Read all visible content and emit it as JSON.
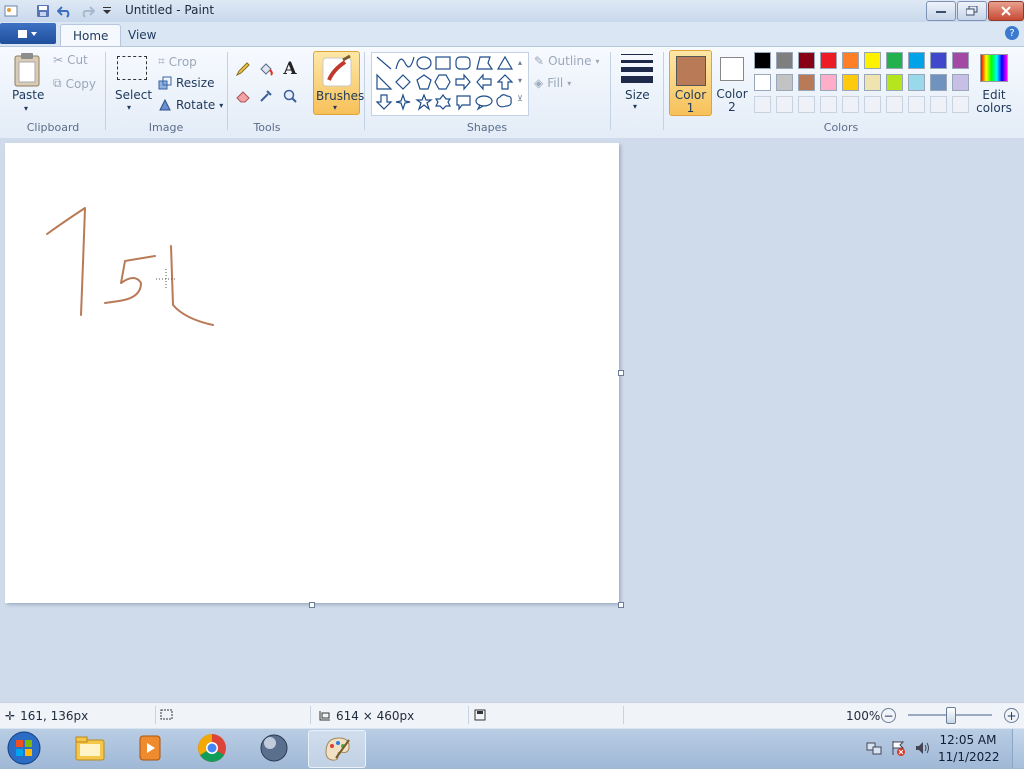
{
  "window": {
    "title": "Untitled - Paint"
  },
  "tabs": {
    "home": "Home",
    "view": "View"
  },
  "ribbon": {
    "clipboard": {
      "paste": "Paste",
      "cut": "Cut",
      "copy": "Copy",
      "group": "Clipboard"
    },
    "image": {
      "select": "Select",
      "crop": "Crop",
      "resize": "Resize",
      "rotate": "Rotate",
      "group": "Image"
    },
    "tools": {
      "group": "Tools"
    },
    "brushes": {
      "label": "Brushes"
    },
    "shapes": {
      "outline": "Outline",
      "fill": "Fill",
      "group": "Shapes"
    },
    "size": {
      "label": "Size"
    },
    "colors": {
      "color1_line1": "Color",
      "color1_line2": "1",
      "color2_line1": "Color",
      "color2_line2": "2",
      "edit_line1": "Edit",
      "edit_line2": "colors",
      "group": "Colors",
      "color1_value": "#b97a57",
      "color2_value": "#ffffff",
      "palette_row1": [
        "#000000",
        "#7f7f7f",
        "#880015",
        "#ed1c24",
        "#ff7f27",
        "#fff200",
        "#22b14c",
        "#00a2e8",
        "#3f48cc",
        "#a349a4"
      ],
      "palette_row2": [
        "#ffffff",
        "#c3c3c3",
        "#b97a57",
        "#ffaec9",
        "#ffc90e",
        "#efe4b0",
        "#b5e61d",
        "#99d9ea",
        "#7092be",
        "#c8bfe7"
      ]
    }
  },
  "status": {
    "cursor": "161, 136px",
    "canvas_size": "614 × 460px",
    "zoom": "100%"
  },
  "taskbar": {
    "time": "12:05 AM",
    "date": "11/1/2022"
  }
}
